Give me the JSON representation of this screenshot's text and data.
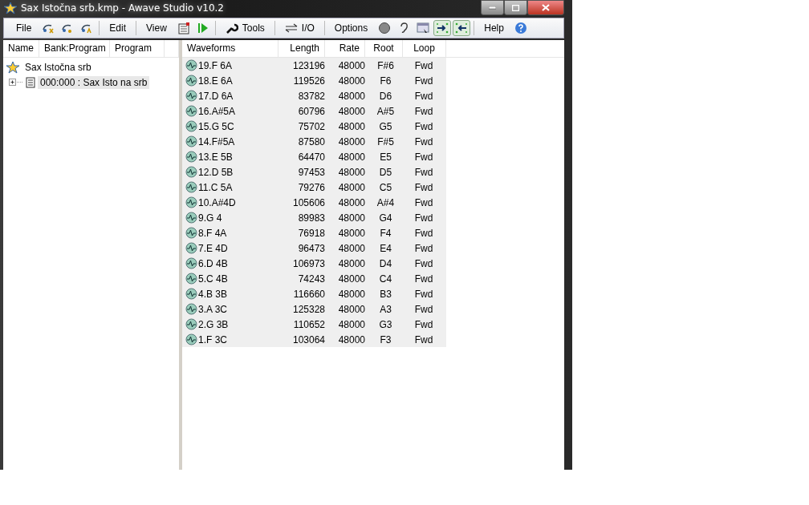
{
  "window": {
    "title": "Sax Istočna srb.kmp - Awave Studio v10.2"
  },
  "toolbar": [
    {
      "kind": "menu",
      "label": "File"
    },
    {
      "kind": "tool"
    },
    {
      "kind": "tool"
    },
    {
      "kind": "tool"
    },
    {
      "kind": "separator"
    },
    {
      "kind": "menu",
      "label": "Edit"
    },
    {
      "kind": "separator"
    },
    {
      "kind": "menu",
      "label": "View"
    },
    {
      "kind": "tool"
    },
    {
      "kind": "tool"
    },
    {
      "kind": "separator"
    },
    {
      "kind": "icon_menu",
      "label": "Tools"
    },
    {
      "kind": "separator"
    },
    {
      "kind": "icon_menu",
      "label": "I/O"
    },
    {
      "kind": "separator"
    },
    {
      "kind": "menu",
      "label": "Options"
    },
    {
      "kind": "tool"
    },
    {
      "kind": "tool"
    },
    {
      "kind": "tool"
    },
    {
      "kind": "tool",
      "pressed": true
    },
    {
      "kind": "tool",
      "pressed": true
    },
    {
      "kind": "separator"
    },
    {
      "kind": "menu",
      "label": "Help"
    },
    {
      "kind": "tool"
    }
  ],
  "tree": {
    "columns": [
      "Name",
      "Bank:Program",
      "Program"
    ],
    "items": [
      {
        "label": "Sax Istočna srb",
        "selected": false,
        "children": [
          {
            "label": "000:000 : Sax Isto na srb",
            "expanded": false,
            "selected": true
          }
        ]
      }
    ]
  },
  "table": {
    "columns": [
      "Waveforms",
      "Length",
      "Rate",
      "Root",
      "Loop"
    ],
    "rows": [
      [
        "19.F 6A",
        "123196",
        "48000",
        "F#6",
        "Fwd"
      ],
      [
        "18.E 6A",
        "119526",
        "48000",
        "F6",
        "Fwd"
      ],
      [
        "17.D 6A",
        "83782",
        "48000",
        "D6",
        "Fwd"
      ],
      [
        "16.A#5A",
        "60796",
        "48000",
        "A#5",
        "Fwd"
      ],
      [
        "15.G 5C",
        "75702",
        "48000",
        "G5",
        "Fwd"
      ],
      [
        "14.F#5A",
        "87580",
        "48000",
        "F#5",
        "Fwd"
      ],
      [
        "13.E 5B",
        "64470",
        "48000",
        "E5",
        "Fwd"
      ],
      [
        "12.D 5B",
        "97453",
        "48000",
        "D5",
        "Fwd"
      ],
      [
        "11.C 5A",
        "79276",
        "48000",
        "C5",
        "Fwd"
      ],
      [
        "10.A#4D",
        "105606",
        "48000",
        "A#4",
        "Fwd"
      ],
      [
        "9.G 4",
        "89983",
        "48000",
        "G4",
        "Fwd"
      ],
      [
        "8.F 4A",
        "76918",
        "48000",
        "F4",
        "Fwd"
      ],
      [
        "7.E 4D",
        "96473",
        "48000",
        "E4",
        "Fwd"
      ],
      [
        "6.D 4B",
        "106973",
        "48000",
        "D4",
        "Fwd"
      ],
      [
        "5.C 4B",
        "74243",
        "48000",
        "C4",
        "Fwd"
      ],
      [
        "4.B 3B",
        "116660",
        "48000",
        "B3",
        "Fwd"
      ],
      [
        "3.A 3C",
        "125328",
        "48000",
        "A3",
        "Fwd"
      ],
      [
        "2.G 3B",
        "110652",
        "48000",
        "G3",
        "Fwd"
      ],
      [
        "1.F 3C",
        "103064",
        "48000",
        "F3",
        "Fwd"
      ]
    ]
  }
}
